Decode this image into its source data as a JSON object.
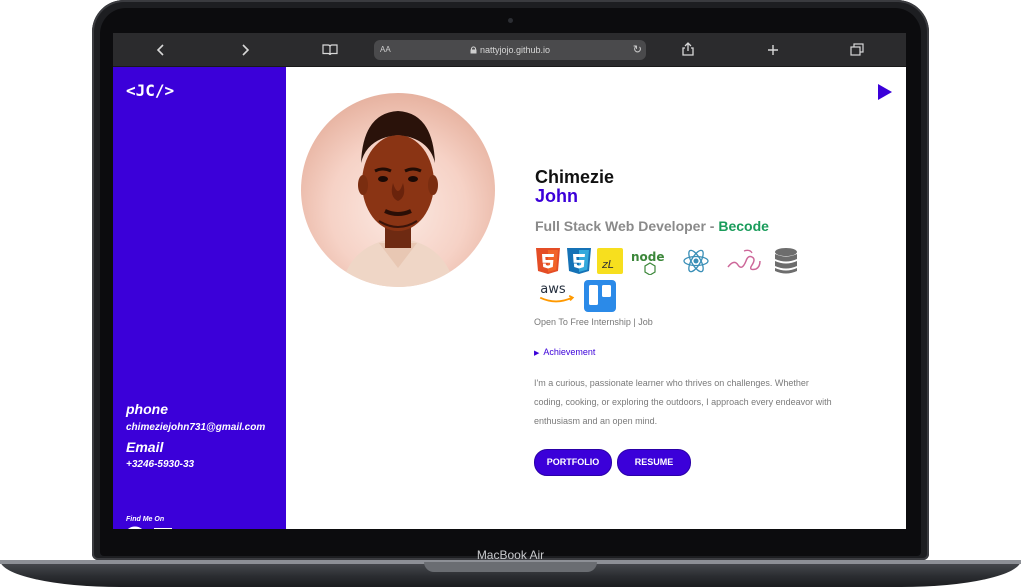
{
  "device": {
    "label": "MacBook Air"
  },
  "browser": {
    "url": "nattyjojo.github.io",
    "reader_label": "AA"
  },
  "sidebar": {
    "logo": "<JC/>",
    "phone_heading": "phone",
    "phone_value": "chimeziejohn731@gmail.com",
    "email_heading": "Email",
    "email_value": "+3246-5930-33",
    "find_label": "Find Me On",
    "social_icons": [
      "github-icon",
      "codepen-icon",
      "discord-icon"
    ]
  },
  "profile": {
    "first_name": "Chimezie",
    "last_name": "John",
    "role": "Full Stack Web Developer - ",
    "org": "Becode",
    "skills": [
      "html5-icon",
      "css3-icon",
      "sass-like-icon",
      "nodejs-icon",
      "react-icon",
      "sass-icon",
      "database-icon",
      "aws-icon",
      "trello-icon"
    ],
    "aws_text": "aws",
    "node_text": "node",
    "availability": "Open To Free Internship | Job",
    "achievement_label": "Achievement",
    "bio": "I'm a curious, passionate learner who thrives on challenges. Whether coding, cooking, or exploring the outdoors, I approach every endeavor with enthusiasm and an open mind.",
    "portfolio_label": "PORTFOLIO",
    "resume_label": "RESUME"
  },
  "colors": {
    "brand": "#3b00d9",
    "accent": "#1a9c5b"
  }
}
